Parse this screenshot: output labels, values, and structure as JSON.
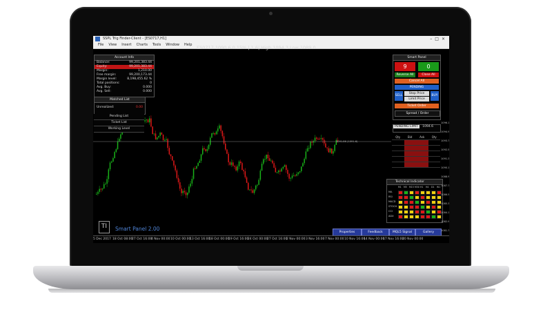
{
  "window": {
    "title": "SSPL Trig Finder-Client - [ES0717,H1]"
  },
  "menu": [
    "File",
    "View",
    "Insert",
    "Charts",
    "Tools",
    "Window",
    "Help"
  ],
  "quote": "ES0717 1090.6  0.15% | 1.6| High 1094.3 Low 1089.0",
  "account": {
    "header": "Account Info",
    "rows": [
      {
        "label": "Balance:",
        "value": "99,201,383.44"
      },
      {
        "label": "Equity:",
        "value": "99,201,383.44"
      },
      {
        "label": "Margin:",
        "value": "1,210.00"
      },
      {
        "label": "Free margin:",
        "value": "99,200,173.44"
      },
      {
        "label": "Margin level:",
        "value": "8,198,455.62 %"
      },
      {
        "label": "Total positions:",
        "value": "0"
      },
      {
        "label": "Avg. Buy:",
        "value": "0.000"
      },
      {
        "label": "Avg. Sell:",
        "value": "0.000"
      }
    ]
  },
  "matched_list": {
    "header": "Matched List",
    "label": "Unrealized:",
    "value": "0.00"
  },
  "dropdowns": [
    "Pending List",
    "Ticket List",
    "Working Level"
  ],
  "smart_panel": {
    "header": "Smart Panel",
    "sell": "Sell",
    "sell_val": "9",
    "buy": "Buy",
    "buy_val": "0",
    "reverse_all": "Reverse All",
    "close_all": "Close All",
    "cancel_all": "Cancel All",
    "pending": "PENDING",
    "sell_btn": "SELL",
    "buy_btn": "BUY",
    "stop_price": "Stop Price",
    "limit_price": "Limit Price",
    "ticket_order": "Ticket Order",
    "spread_header": "Spread / Order",
    "pending_limit": "PENDING LIMIT",
    "price": "1094.6"
  },
  "order_table": {
    "headers": [
      "Qty",
      "Bid",
      "Ask",
      "Qty"
    ]
  },
  "technical": {
    "header": "Technical Indicator",
    "cols": [
      "M1",
      "M5",
      "M15",
      "M30",
      "H1",
      "H4",
      "D1",
      "W1"
    ],
    "rows": [
      "MA",
      "RSI",
      "MACD",
      "STOCH",
      "CCI",
      "ADX"
    ]
  },
  "tabs": [
    "Properties",
    "Feedback",
    "MQL5 Signal",
    "Gallery"
  ],
  "logo": "TI",
  "brand": "Smart Panel 2.00",
  "crosshair_label": "1091.86 (1091.6)",
  "time_axis": [
    "5 Dec 2017",
    "18 Oct 08:00",
    "27 Oct 16:00",
    "4 Nov 00:00",
    "10 Oct 00:00",
    "13 Oct 16:00",
    "18 Oct 00:00",
    "19 Oct 16:00",
    "24 Oct 00:00",
    "27 Oct 16:00",
    "2 Nov 00:00",
    "3 Nov 16:00",
    "7 Nov 00:00",
    "10 Nov 16:00",
    "14 Nov 00:00",
    "17 Nov 16:00",
    "20 Nov 00:00"
  ],
  "price_axis": [
    "1096.1",
    "1094.9",
    "1093.7",
    "1092.5",
    "1091.3",
    "1090.1",
    "1088.9",
    "1087.7",
    "1086.5",
    "1085.3",
    "1084.1",
    "1082.9",
    "1081.7"
  ],
  "colors": {
    "bull": "#19b319",
    "bear": "#e01818",
    "accent": "#263a9a"
  }
}
